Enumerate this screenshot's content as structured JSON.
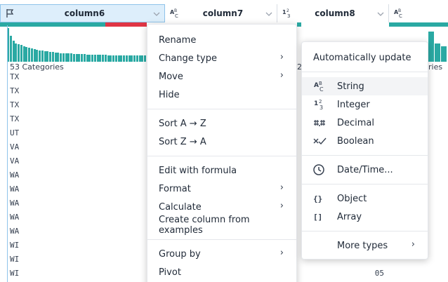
{
  "columns": [
    {
      "name": "column6",
      "type_icon": "flag-icon"
    },
    {
      "name": "column7",
      "type_icon": "string-type-icon",
      "type_glyph_top": "A",
      "type_glyph_sub": "B",
      "type_glyph_sub2": "C"
    },
    {
      "name": "column8",
      "type_icon": "integer-type-icon",
      "type_glyph_top": "1",
      "type_glyph_sub": "2",
      "type_glyph_sub2": "3"
    },
    {
      "name": "",
      "type_icon": "string-type-icon",
      "type_glyph_top": "A",
      "type_glyph_sub": "B",
      "type_glyph_sub2": "C"
    }
  ],
  "profile": {
    "categories_label": "53 Categories",
    "column8_fragment": "2",
    "column9_fragment": "ries"
  },
  "rows": [
    {
      "a": "TX",
      "b": ""
    },
    {
      "a": "TX",
      "b": ""
    },
    {
      "a": "TX",
      "b": ""
    },
    {
      "a": "TX",
      "b": ""
    },
    {
      "a": "UT",
      "b": ""
    },
    {
      "a": "VA",
      "b": ""
    },
    {
      "a": "VA",
      "b": ""
    },
    {
      "a": "WA",
      "b": ""
    },
    {
      "a": "WA",
      "b": ""
    },
    {
      "a": "WA",
      "b": ""
    },
    {
      "a": "WA",
      "b": ""
    },
    {
      "a": "WA",
      "b": ""
    },
    {
      "a": "WI",
      "b": ""
    },
    {
      "a": "WI",
      "b": ""
    },
    {
      "a": "WI",
      "b": "05"
    }
  ],
  "main_menu": {
    "rename": "Rename",
    "change_type": "Change type",
    "move": "Move",
    "hide": "Hide",
    "sort_az": "Sort A → Z",
    "sort_za": "Sort Z → A",
    "edit_formula": "Edit with formula",
    "format": "Format",
    "calculate": "Calculate",
    "create_from_examples": "Create column from examples",
    "group_by": "Group by",
    "pivot": "Pivot"
  },
  "type_menu": {
    "auto_update": "Automatically update",
    "string": "String",
    "integer": "Integer",
    "decimal": "Decimal",
    "boolean": "Boolean",
    "datetime": "Date/Time...",
    "object": "Object",
    "array": "Array",
    "more_types": "More types"
  },
  "icons": {
    "chevron_down": "⌄",
    "chevron_right": "›",
    "string_glyph": "ABC",
    "integer_glyph": "123",
    "decimal_glyph": "#.#",
    "boolean_glyph": "✓",
    "object_glyph": "{}",
    "array_glyph": "[]"
  },
  "colors": {
    "accent": "#2aa9a3",
    "invalid": "#e03545",
    "selected_header": "#ddeefb"
  },
  "histogram": {
    "column6_values": [
      1.0,
      0.78,
      0.62,
      0.55,
      0.52,
      0.5,
      0.46,
      0.44,
      0.42,
      0.4,
      0.38,
      0.36,
      0.34,
      0.33,
      0.32,
      0.31,
      0.3,
      0.29,
      0.28,
      0.27,
      0.26,
      0.25,
      0.25,
      0.24,
      0.24,
      0.23,
      0.23,
      0.22,
      0.22,
      0.22,
      0.21,
      0.21,
      0.21,
      0.2,
      0.2,
      0.2,
      0.2,
      0.2,
      0.19,
      0.19,
      0.19,
      0.19,
      0.19,
      0.18,
      0.18,
      0.18,
      0.18,
      0.18,
      0.18,
      0.18,
      0.18,
      0.18,
      0.18
    ],
    "column9_values": [
      0.9,
      0.55,
      0.45
    ]
  }
}
